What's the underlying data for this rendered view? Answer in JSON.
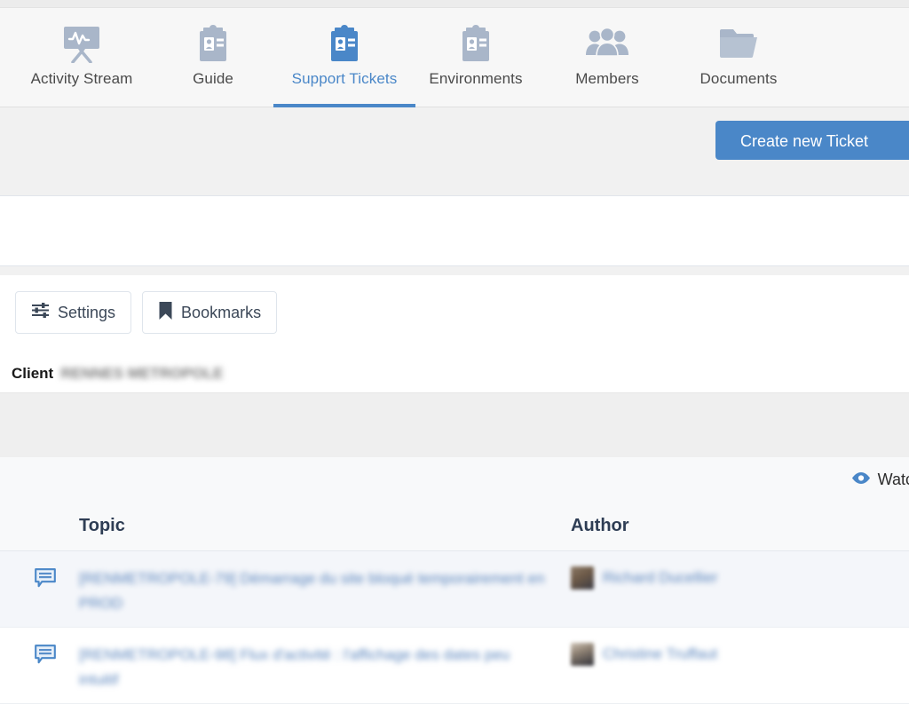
{
  "nav": {
    "items": [
      {
        "label": "Activity Stream",
        "icon": "activity-stream-icon",
        "active": false
      },
      {
        "label": "Guide",
        "icon": "clipboard-icon",
        "active": false
      },
      {
        "label": "Support Tickets",
        "icon": "clipboard-icon",
        "active": true
      },
      {
        "label": "Environments",
        "icon": "clipboard-icon",
        "active": false
      },
      {
        "label": "Members",
        "icon": "people-icon",
        "active": false
      },
      {
        "label": "Documents",
        "icon": "folder-icon",
        "active": false
      }
    ]
  },
  "actionbar": {
    "create_ticket_label": "Create new Ticket"
  },
  "toolbar": {
    "settings_label": "Settings",
    "settings_icon": "sliders-icon",
    "bookmarks_label": "Bookmarks",
    "bookmarks_icon": "bookmark-icon"
  },
  "client": {
    "label": "Client",
    "value": "RENNES METROPOLE"
  },
  "watch": {
    "label": "Watch",
    "icon": "eye-icon"
  },
  "table": {
    "headers": {
      "topic": "Topic",
      "author": "Author"
    },
    "rows": [
      {
        "icon": "comment-icon",
        "topic": "[RENMETROPOLE-79] Démarrage du site bloqué temporairement en PROD",
        "author": "Richard Ducellier"
      },
      {
        "icon": "comment-icon",
        "topic": "[RENMETROPOLE-98] Flux d'activité : l'affichage des dates peu intuitif",
        "author": "Christine Truffaut"
      }
    ]
  },
  "colors": {
    "accent_blue": "#4a87c8",
    "link_blue": "#5a85bd",
    "icon_gray": "#a9b6c9",
    "header_navy": "#2e3d54",
    "page_gray": "#f1f1f1"
  }
}
